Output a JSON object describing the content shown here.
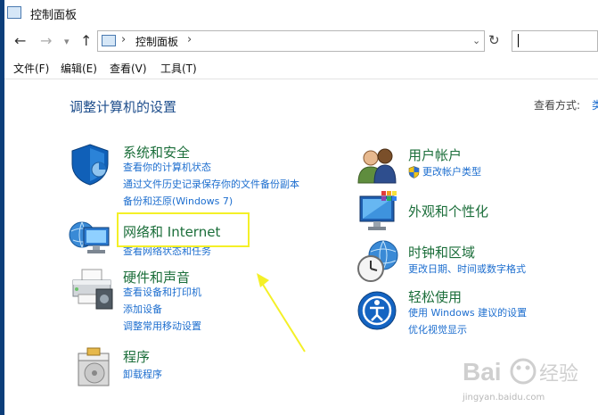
{
  "window": {
    "title": "控制面板"
  },
  "nav": {
    "back": "←",
    "forward": "→",
    "dropdown": "▾",
    "up": "↑",
    "refresh": "↻"
  },
  "address": {
    "separator": "›",
    "path": "控制面板",
    "path_arrow": "›",
    "dropdown": "⌄"
  },
  "menu": [
    "文件(F)",
    "编辑(E)",
    "查看(V)",
    "工具(T)"
  ],
  "main": {
    "heading": "调整计算机的设置",
    "view_by_label": "查看方式:",
    "view_by_value": "类"
  },
  "categories_left": [
    {
      "title": "系统和安全",
      "icon": "shield-icon",
      "links": [
        "查看你的计算机状态",
        "通过文件历史记录保存你的文件备份副本",
        "备份和还原(Windows 7)"
      ]
    },
    {
      "title": "网络和 Internet",
      "icon": "network-icon",
      "links": [
        "查看网络状态和任务"
      ]
    },
    {
      "title": "硬件和声音",
      "icon": "printer-icon",
      "links": [
        "查看设备和打印机",
        "添加设备",
        "调整常用移动设置"
      ]
    },
    {
      "title": "程序",
      "icon": "programs-icon",
      "links": [
        "卸载程序"
      ]
    }
  ],
  "categories_right": [
    {
      "title": "用户帐户",
      "icon": "users-icon",
      "links": [
        "更改帐户类型"
      ]
    },
    {
      "title": "外观和个性化",
      "icon": "monitor-palette-icon",
      "links": []
    },
    {
      "title": "时钟和区域",
      "icon": "clock-globe-icon",
      "links": [
        "更改日期、时间或数字格式"
      ]
    },
    {
      "title": "轻松使用",
      "icon": "ease-of-access-icon",
      "links": [
        "使用 Windows 建议的设置",
        "优化视觉显示"
      ]
    }
  ],
  "watermark": {
    "brand": "Bai",
    "brand2": "经验",
    "url": "jingyan.baidu.com"
  },
  "colors": {
    "accent": "#1d6ecf",
    "category": "#1b6e3a",
    "highlight": "#f4f027",
    "arrow": "#f4f027"
  }
}
